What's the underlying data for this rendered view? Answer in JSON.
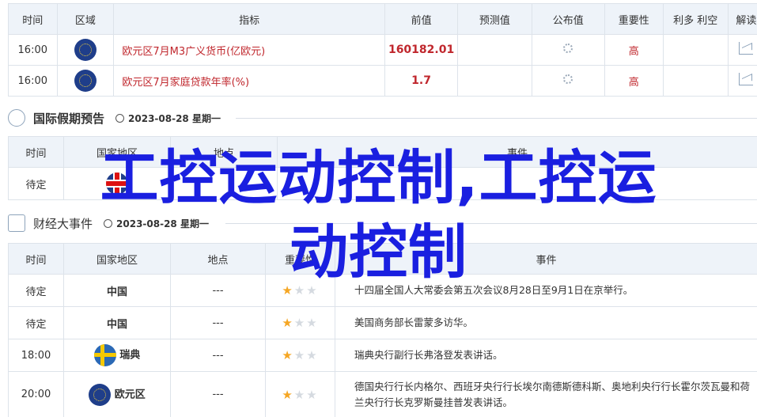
{
  "calendar": {
    "headers": [
      "时间",
      "区域",
      "指标",
      "前值",
      "预测值",
      "公布值",
      "重要性",
      "利多 利空",
      "解读"
    ],
    "rows": [
      {
        "time": "16:00",
        "flag": "eu-flag",
        "indicator": "欧元区7月M3广义货币(亿欧元)",
        "previous": "160182.01",
        "forecast": "",
        "actual_icon": "loading-icon",
        "importance": "高",
        "impact": "",
        "analysis_icon": "chart-icon"
      },
      {
        "time": "16:00",
        "flag": "eu-flag",
        "indicator": "欧元区7月家庭贷款年率(%)",
        "previous": "1.7",
        "forecast": "",
        "actual_icon": "loading-icon",
        "importance": "高",
        "impact": "",
        "analysis_icon": "chart-icon"
      }
    ]
  },
  "holidays": {
    "title": "国际假期预告",
    "date": "2023-08-28 星期一",
    "headers": [
      "时间",
      "国家地区",
      "地点",
      "事件"
    ],
    "rows": [
      {
        "time": "待定",
        "flag": "uk-flag",
        "region": "",
        "place": "",
        "event": ""
      }
    ]
  },
  "events": {
    "title": "财经大事件",
    "date": "2023-08-28 星期一",
    "headers": [
      "时间",
      "国家地区",
      "地点",
      "重要性",
      "事件"
    ],
    "rows": [
      {
        "time": "待定",
        "region": "中国",
        "place": "---",
        "stars": 1,
        "event": "十四届全国人大常委会第五次会议8月28日至9月1日在京举行。"
      },
      {
        "time": "待定",
        "region": "中国",
        "place": "---",
        "stars": 1,
        "event": "美国商务部长雷蒙多访华。"
      },
      {
        "time": "18:00",
        "region": "瑞典",
        "flag": "se-flag",
        "place": "---",
        "stars": 1,
        "event": "瑞典央行副行长弗洛登发表讲话。"
      },
      {
        "time": "20:00",
        "region": "欧元区",
        "flag": "eu-flag",
        "place": "---",
        "stars": 1,
        "event": "德国央行行长内格尔、西班牙央行行长埃尔南德斯德科斯、奥地利央行行长霍尔茨瓦曼和荷兰央行行长克罗斯曼挂普发表讲话。"
      }
    ]
  },
  "watermark": {
    "line1": "工控运动控制,工控运",
    "line2": "动控制"
  },
  "colors": {
    "accent_red": "#c0272d",
    "header_bg": "#eef3f9",
    "watermark_blue": "#1a1fe0",
    "star_gold": "#f5a623"
  }
}
